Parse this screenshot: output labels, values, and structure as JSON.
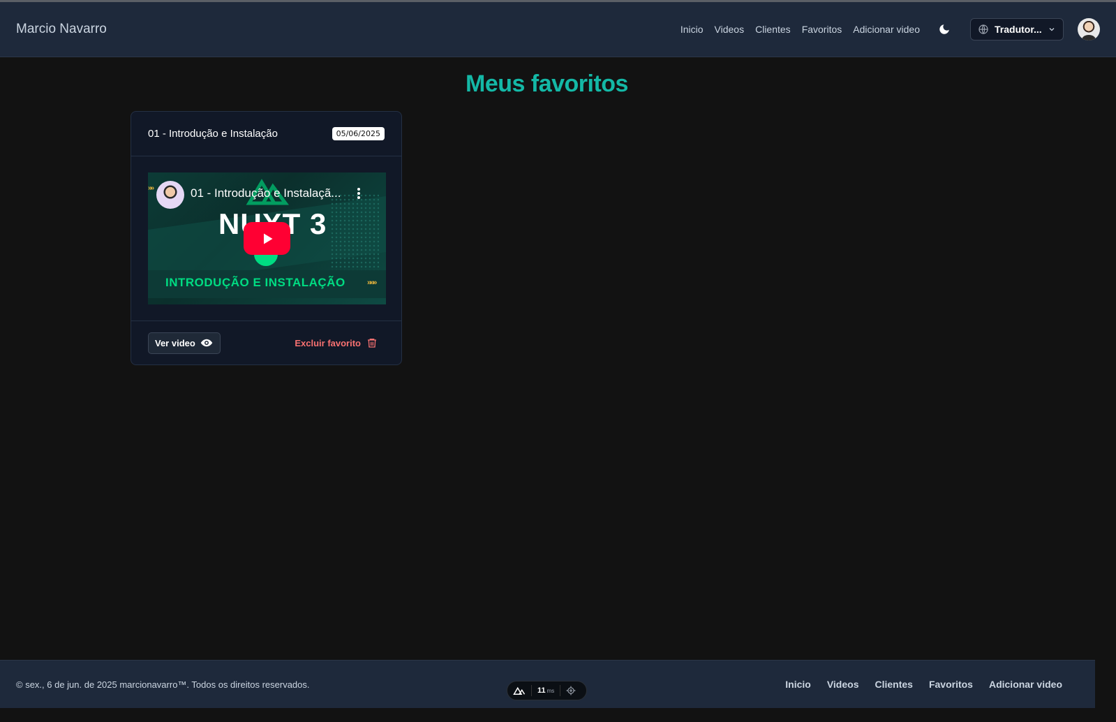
{
  "header": {
    "brand": "Marcio Navarro",
    "nav": [
      "Inicio",
      "Videos",
      "Clientes",
      "Favoritos",
      "Adicionar video"
    ],
    "translate_label": "Tradutor..."
  },
  "page": {
    "title": "Meus favoritos"
  },
  "favorites": [
    {
      "title": "01 - Introdução e Instalação",
      "date": "05/06/2025",
      "video": {
        "title": "01 - Introdução e Instalaçã...",
        "thumb_heading": "NUXT 3",
        "thumb_subtitle": "INTRODUÇÃO E INSTALAÇÃO"
      },
      "view_label": "Ver video",
      "delete_label": "Excluir favorito"
    }
  ],
  "footer": {
    "copyright": "© sex., 6 de jun. de 2025 marcionavarro™. Todos os direitos reservados.",
    "nav": [
      "Inicio",
      "Videos",
      "Clientes",
      "Favoritos",
      "Adicionar video"
    ]
  },
  "devtools": {
    "time": "11",
    "unit": "ms"
  },
  "colors": {
    "accent": "#14b8a6",
    "danger": "#f87171",
    "header_bg": "#1e293b",
    "page_bg": "#121212"
  }
}
